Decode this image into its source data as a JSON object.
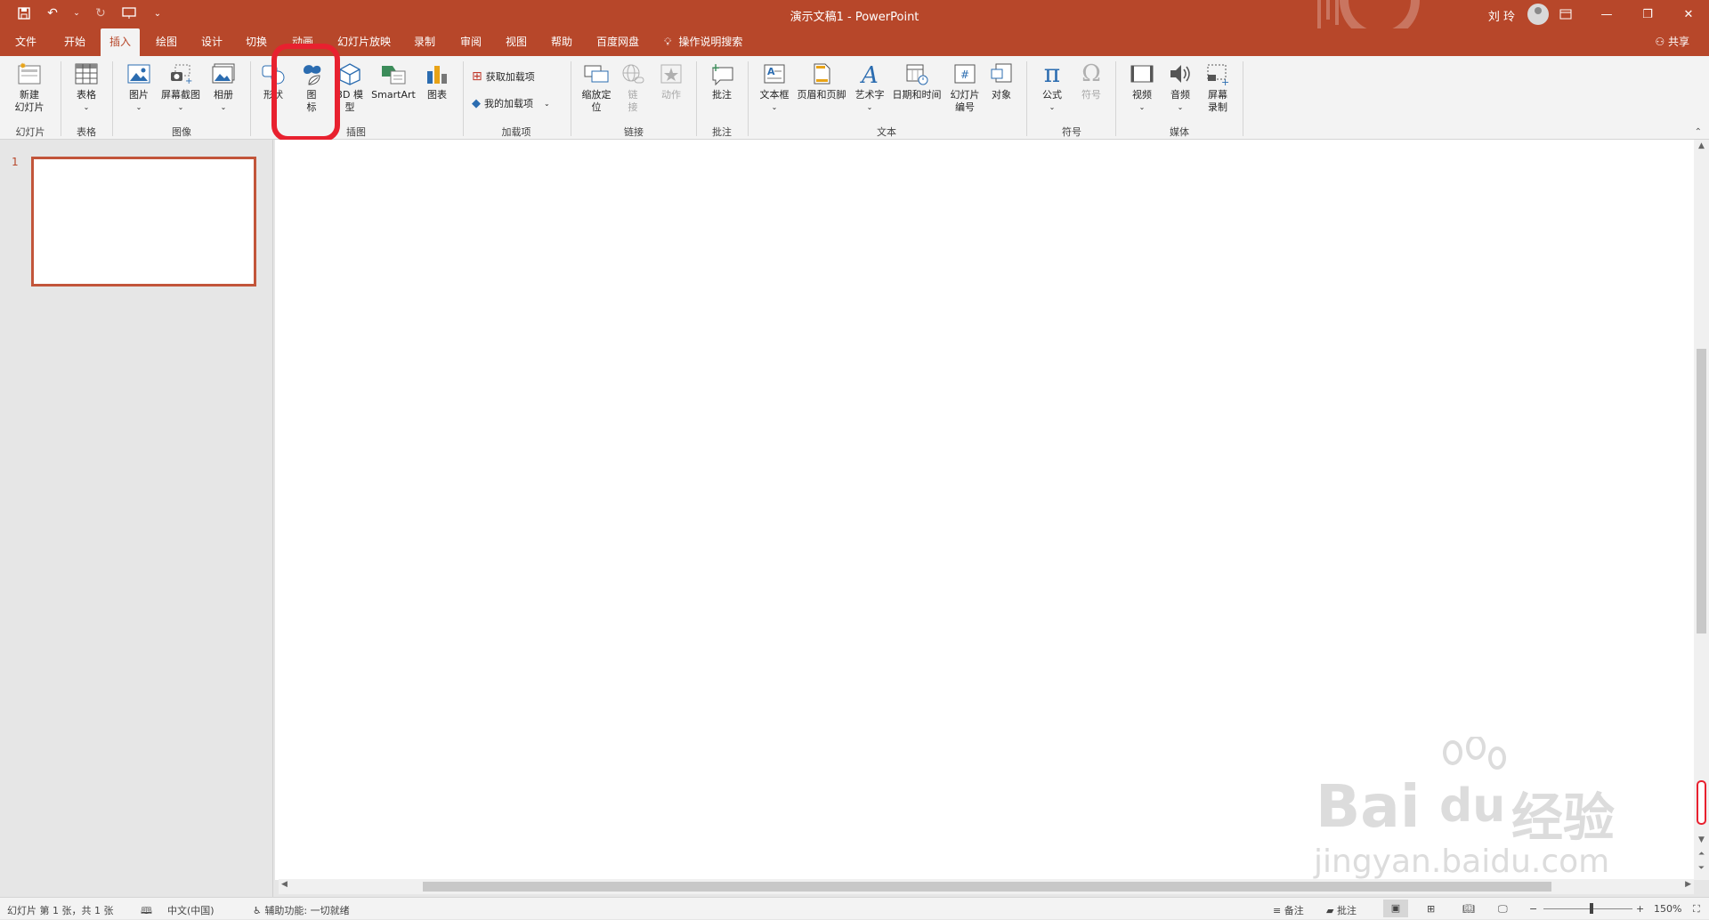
{
  "window": {
    "title": "演示文稿1  -  PowerPoint",
    "user": "刘 玲",
    "accent": "#b7472a",
    "highlight": "#e8212f"
  },
  "quick_access": [
    "save-icon",
    "undo-icon",
    "redo-icon",
    "present-icon",
    "customize-icon"
  ],
  "tabs": [
    {
      "label": "文件"
    },
    {
      "label": "开始"
    },
    {
      "label": "插入",
      "active": true
    },
    {
      "label": "绘图"
    },
    {
      "label": "设计"
    },
    {
      "label": "切换"
    },
    {
      "label": "动画"
    },
    {
      "label": "幻灯片放映"
    },
    {
      "label": "录制"
    },
    {
      "label": "审阅"
    },
    {
      "label": "视图"
    },
    {
      "label": "帮助"
    },
    {
      "label": "百度网盘"
    },
    {
      "label": "操作说明搜索"
    }
  ],
  "share_label": "共享",
  "ribbon": {
    "new_slide": "新建\n幻灯片",
    "table": "表格",
    "picture": "图片",
    "screenshot": "屏幕截图",
    "album": "相册",
    "shapes": "形状",
    "icons": "图\n标",
    "models_3d": "3D 模\n型",
    "smartart": "SmartArt",
    "chart": "图表",
    "get_addins": "获取加载项",
    "my_addins": "我的加载项",
    "zoom": "缩放定\n位",
    "link": "链\n接",
    "action": "动作",
    "comment": "批注",
    "textbox": "文本框",
    "header_footer": "页眉和页脚",
    "wordart": "艺术字",
    "datetime": "日期和时间",
    "slide_number": "幻灯片\n编号",
    "object": "对象",
    "equation": "公式",
    "symbol": "符号",
    "video": "视频",
    "audio": "音频",
    "screen_record": "屏幕\n录制",
    "groups": {
      "slides": "幻灯片",
      "tables": "表格",
      "images": "图像",
      "illustrations": "插图",
      "addins": "加载项",
      "links": "链接",
      "comments": "批注",
      "text": "文本",
      "symbols": "符号",
      "media": "媒体"
    }
  },
  "thumbnail": {
    "number": "1"
  },
  "watermark": {
    "brand": "Bai",
    "brand2": "du",
    "cn": "经验",
    "url": "jingyan.baidu.com"
  },
  "status": {
    "slide_info": "幻灯片 第 1 张，共 1 张",
    "language": "中文(中国)",
    "accessibility": "辅助功能: 一切就绪",
    "notes": "备注",
    "comments": "批注",
    "zoom": "150%"
  }
}
